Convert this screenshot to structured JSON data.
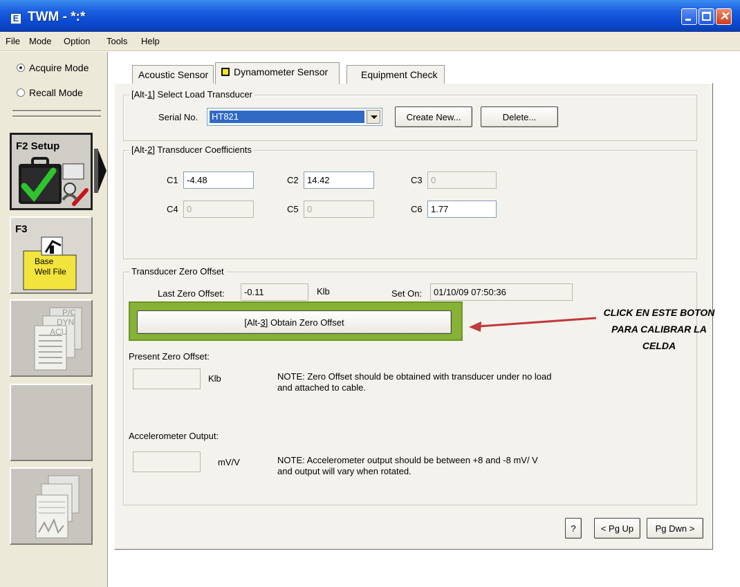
{
  "window": {
    "icon_glyph": "E",
    "title": "TWM  -  *:*",
    "controls": {
      "minimize": "minimize-icon",
      "maximize": "maximize-icon",
      "close": "close-icon",
      "close_glyph": "✕"
    }
  },
  "menu": [
    "File",
    "Mode",
    "Option",
    "Tools",
    "Help"
  ],
  "left_panel": {
    "modes": [
      {
        "label": "Acquire Mode",
        "underline": "A",
        "selected": true
      },
      {
        "label": "Recall Mode",
        "underline": "R",
        "selected": false
      }
    ],
    "nav": [
      {
        "key": "F2",
        "label": "F2 Setup",
        "active": true
      },
      {
        "key": "F3",
        "label": "F3",
        "folder_label": "Base\nWell File",
        "folder_line1": "Base",
        "folder_line2": "Well File"
      },
      {
        "label": "P/C DYN ACU",
        "tags": [
          "P/C",
          "DYN",
          "ACU"
        ],
        "disabled": true
      },
      {
        "label": "",
        "disabled": true
      },
      {
        "label": "",
        "disabled": true
      }
    ]
  },
  "tabs": [
    {
      "label": "Acoustic Sensor",
      "active": false
    },
    {
      "label": "Dynamometer Sensor",
      "active": true
    },
    {
      "label": "Equipment Check",
      "active": false
    }
  ],
  "load_transducer": {
    "legend_prefix": "[Alt-",
    "legend_key": "1",
    "legend_suffix": "]  Select Load Transducer",
    "serial_label": "Serial No.",
    "serial_value": "HT821",
    "create_button": "Create New...",
    "create_button_underline": "C",
    "delete_button": "Delete...",
    "delete_button_underline": "D"
  },
  "coefficients": {
    "legend_prefix": "[Alt-",
    "legend_key": "2",
    "legend_suffix": "]  Transducer Coefficients",
    "fields": [
      {
        "label": "C1",
        "value": "-4.48",
        "enabled": true
      },
      {
        "label": "C2",
        "value": "14.42",
        "enabled": true
      },
      {
        "label": "C3",
        "value": "0",
        "enabled": false
      },
      {
        "label": "C4",
        "value": "0",
        "enabled": false
      },
      {
        "label": "C5",
        "value": "0",
        "enabled": false
      },
      {
        "label": "C6",
        "value": "1.77",
        "enabled": true
      }
    ]
  },
  "zero_offset": {
    "legend": "Transducer Zero Offset",
    "last_label": "Last Zero Offset:",
    "last_value": "-0.11",
    "last_unit": "Klb",
    "set_on_label": "Set On:",
    "set_on_value": "01/10/09 07:50:36",
    "obtain_prefix": "[Alt-",
    "obtain_key": "3",
    "obtain_suffix": "]  Obtain Zero Offset",
    "present_label": "Present Zero Offset:",
    "present_value": "",
    "present_unit": "Klb",
    "note_zero_line1": "NOTE: Zero Offset should be obtained with transducer under no load",
    "note_zero_line2": "and attached to cable.",
    "accel_label": "Accelerometer Output:",
    "accel_value": "",
    "accel_unit": "mV/V",
    "note_accel_line1": "NOTE:  Accelerometer output should be between +8 and -8 mV/ V",
    "note_accel_line2": "and output will vary when rotated."
  },
  "footer_buttons": {
    "help": "?",
    "pgup": "< Pg Up",
    "pgdown": "Pg Dwn >"
  },
  "annotation": {
    "line1": "CLICK EN ESTE BOTON",
    "line2": "PARA CALIBRAR LA",
    "line3": "CELDA"
  },
  "colors": {
    "titlebar": "#0b4bd2",
    "highlight": "#86b236",
    "arrow": "#c0393b",
    "selection": "#316ac5"
  }
}
